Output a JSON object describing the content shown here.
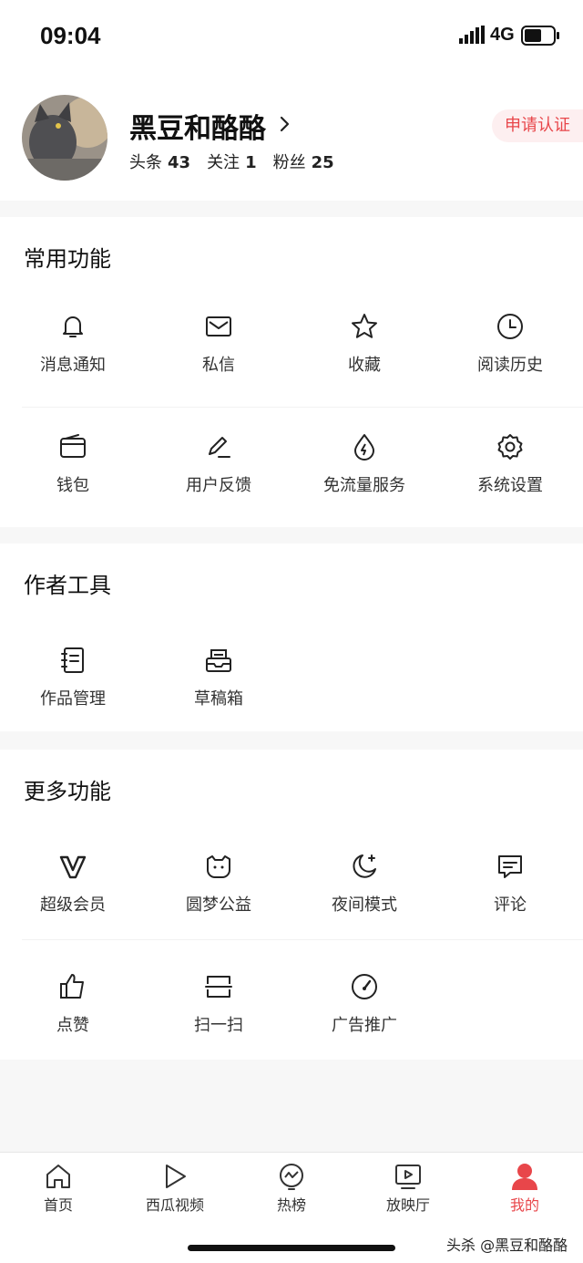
{
  "status_bar": {
    "time": "09:04",
    "network": "4G"
  },
  "profile": {
    "username": "黑豆和酪酪",
    "stats": [
      {
        "label": "头条",
        "value": "43"
      },
      {
        "label": "关注",
        "value": "1"
      },
      {
        "label": "粉丝",
        "value": "25"
      }
    ],
    "verify_label": "申请认证"
  },
  "sections": {
    "common": {
      "title": "常用功能",
      "items": [
        {
          "label": "消息通知",
          "icon": "bell-icon"
        },
        {
          "label": "私信",
          "icon": "mail-icon"
        },
        {
          "label": "收藏",
          "icon": "star-icon"
        },
        {
          "label": "阅读历史",
          "icon": "clock-icon"
        },
        {
          "label": "钱包",
          "icon": "wallet-icon"
        },
        {
          "label": "用户反馈",
          "icon": "pen-icon"
        },
        {
          "label": "免流量服务",
          "icon": "data-drop-icon"
        },
        {
          "label": "系统设置",
          "icon": "gear-icon"
        }
      ]
    },
    "author": {
      "title": "作者工具",
      "items": [
        {
          "label": "作品管理",
          "icon": "notebook-icon"
        },
        {
          "label": "草稿箱",
          "icon": "drafts-icon"
        }
      ]
    },
    "more": {
      "title": "更多功能",
      "items": [
        {
          "label": "超级会员",
          "icon": "vip-icon"
        },
        {
          "label": "圆梦公益",
          "icon": "charity-icon"
        },
        {
          "label": "夜间模式",
          "icon": "moon-icon"
        },
        {
          "label": "评论",
          "icon": "comment-icon"
        },
        {
          "label": "点赞",
          "icon": "thumbs-up-icon"
        },
        {
          "label": "扫一扫",
          "icon": "scan-icon"
        },
        {
          "label": "广告推广",
          "icon": "gauge-icon"
        }
      ]
    }
  },
  "tabbar": {
    "tabs": [
      {
        "label": "首页",
        "icon": "home-icon"
      },
      {
        "label": "西瓜视频",
        "icon": "play-icon"
      },
      {
        "label": "热榜",
        "icon": "trending-icon"
      },
      {
        "label": "放映厅",
        "icon": "tv-icon"
      },
      {
        "label": "我的",
        "icon": "user-icon",
        "active": true
      }
    ]
  },
  "watermark": "头杀 @黑豆和酪酪",
  "colors": {
    "accent": "#e8464a",
    "verify_bg": "#fdeff0",
    "background": "#f7f7f7"
  }
}
